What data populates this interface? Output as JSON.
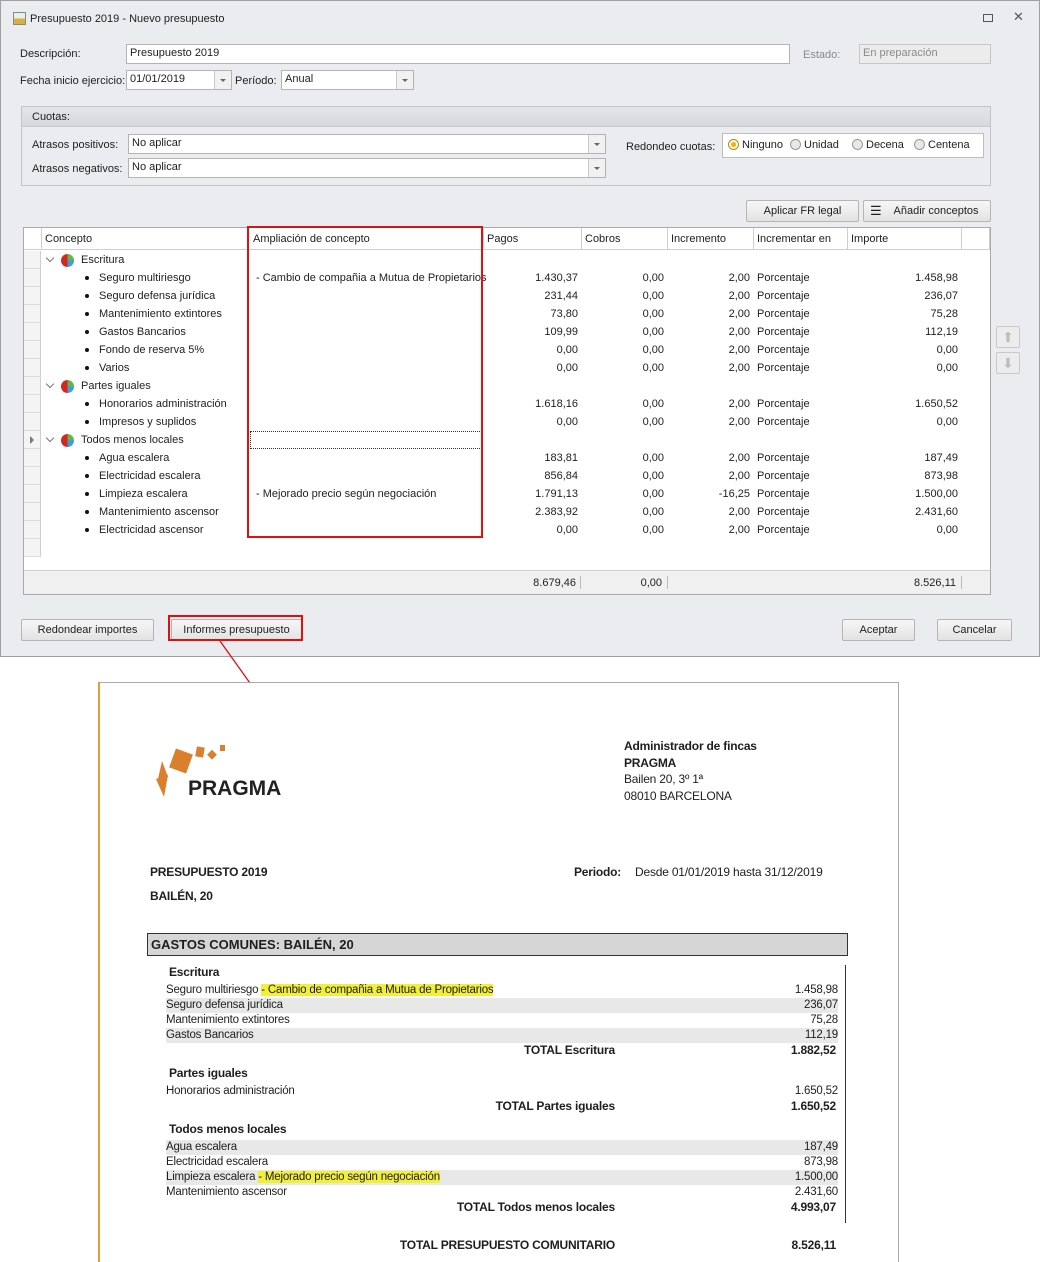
{
  "window": {
    "title": "Presupuesto 2019 - Nuevo presupuesto"
  },
  "form": {
    "descripcion_label": "Descripción:",
    "descripcion_value": "Presupuesto 2019",
    "estado_label": "Estado:",
    "estado_value": "En preparación",
    "fecha_label": "Fecha inicio ejercicio:",
    "fecha_value": "01/01/2019",
    "periodo_label": "Período:",
    "periodo_value": "Anual"
  },
  "cuotas": {
    "title": "Cuotas:",
    "atrasos_pos_label": "Atrasos positivos:",
    "atrasos_pos_value": "No aplicar",
    "atrasos_neg_label": "Atrasos negativos:",
    "atrasos_neg_value": "No aplicar",
    "redondeo_label": "Redondeo cuotas:",
    "redondeo_options": [
      "Ninguno",
      "Unidad",
      "Decena",
      "Centena"
    ],
    "redondeo_selected": "Ninguno"
  },
  "toolbar": {
    "aplicar_fr": "Aplicar FR legal",
    "anadir": "Añadir conceptos"
  },
  "grid": {
    "columns": [
      "Concepto",
      "Ampliación de concepto",
      "Pagos",
      "Cobros",
      "Incremento",
      "Incrementar en",
      "Importe"
    ],
    "rows": [
      {
        "group": "Escritura"
      },
      {
        "c": "Seguro multiriesgo",
        "a": "- Cambio de compañia a Mutua de Propietarios",
        "p": "1.430,37",
        "co": "0,00",
        "i": "2,00",
        "e": "Porcentaje",
        "im": "1.458,98"
      },
      {
        "c": "Seguro defensa jurídica",
        "a": "",
        "p": "231,44",
        "co": "0,00",
        "i": "2,00",
        "e": "Porcentaje",
        "im": "236,07"
      },
      {
        "c": "Mantenimiento extintores",
        "a": "",
        "p": "73,80",
        "co": "0,00",
        "i": "2,00",
        "e": "Porcentaje",
        "im": "75,28"
      },
      {
        "c": "Gastos Bancarios",
        "a": "",
        "p": "109,99",
        "co": "0,00",
        "i": "2,00",
        "e": "Porcentaje",
        "im": "112,19"
      },
      {
        "c": "Fondo de reserva 5%",
        "a": "",
        "p": "0,00",
        "co": "0,00",
        "i": "2,00",
        "e": "Porcentaje",
        "im": "0,00"
      },
      {
        "c": "Varios",
        "a": "",
        "p": "0,00",
        "co": "0,00",
        "i": "2,00",
        "e": "Porcentaje",
        "im": "0,00"
      },
      {
        "group": "Partes iguales"
      },
      {
        "c": "Honorarios administración",
        "a": "",
        "p": "1.618,16",
        "co": "0,00",
        "i": "2,00",
        "e": "Porcentaje",
        "im": "1.650,52"
      },
      {
        "c": "Impresos y suplidos",
        "a": "",
        "p": "0,00",
        "co": "0,00",
        "i": "2,00",
        "e": "Porcentaje",
        "im": "0,00"
      },
      {
        "group": "Todos menos locales",
        "current": true
      },
      {
        "c": "Agua escalera",
        "a": "",
        "p": "183,81",
        "co": "0,00",
        "i": "2,00",
        "e": "Porcentaje",
        "im": "187,49"
      },
      {
        "c": "Electricidad escalera",
        "a": "",
        "p": "856,84",
        "co": "0,00",
        "i": "2,00",
        "e": "Porcentaje",
        "im": "873,98"
      },
      {
        "c": "Limpieza escalera",
        "a": "- Mejorado precio según negociación",
        "p": "1.791,13",
        "co": "0,00",
        "i": "-16,25",
        "e": "Porcentaje",
        "im": "1.500,00"
      },
      {
        "c": "Mantenimiento ascensor",
        "a": "",
        "p": "2.383,92",
        "co": "0,00",
        "i": "2,00",
        "e": "Porcentaje",
        "im": "2.431,60"
      },
      {
        "c": "Electricidad ascensor",
        "a": "",
        "p": "0,00",
        "co": "0,00",
        "i": "2,00",
        "e": "Porcentaje",
        "im": "0,00"
      }
    ],
    "totals": {
      "pagos": "8.679,46",
      "cobros": "0,00",
      "importe": "8.526,11"
    }
  },
  "buttons": {
    "redondear": "Redondear importes",
    "informes": "Informes presupuesto",
    "aceptar": "Aceptar",
    "cancelar": "Cancelar"
  },
  "report": {
    "logo_text": "PRAGMA",
    "company": [
      "Administrador de fincas",
      "PRAGMA",
      "Bailen 20, 3º 1ª",
      "08010 BARCELONA"
    ],
    "title": "PRESUPUESTO 2019",
    "building": "BAILÉN, 20",
    "periodo_label": "Periodo:",
    "periodo_value": "Desde 01/01/2019 hasta 31/12/2019",
    "section": "GASTOS COMUNES: BAILÉN, 20",
    "groups": [
      {
        "name": "Escritura",
        "items": [
          {
            "c": "Seguro multiriesgo",
            "a": "- Cambio de compañia a Mutua de Propietarios",
            "v": "1.458,98"
          },
          {
            "c": "Seguro defensa jurídica",
            "a": "",
            "v": "236,07"
          },
          {
            "c": "Mantenimiento extintores",
            "a": "",
            "v": "75,28"
          },
          {
            "c": "Gastos Bancarios",
            "a": "",
            "v": "112,19"
          }
        ],
        "total_label": "TOTAL Escritura",
        "total": "1.882,52"
      },
      {
        "name": "Partes iguales",
        "items": [
          {
            "c": "Honorarios administración",
            "a": "",
            "v": "1.650,52"
          }
        ],
        "total_label": "TOTAL Partes iguales",
        "total": "1.650,52"
      },
      {
        "name": "Todos menos locales",
        "items": [
          {
            "c": "Agua escalera",
            "a": "",
            "v": "187,49"
          },
          {
            "c": "Electricidad escalera",
            "a": "",
            "v": "873,98"
          },
          {
            "c": "Limpieza escalera",
            "a": "- Mejorado precio según negociación",
            "v": "1.500,00"
          },
          {
            "c": "Mantenimiento ascensor",
            "a": "",
            "v": "2.431,60"
          }
        ],
        "total_label": "TOTAL Todos menos locales",
        "total": "4.993,07"
      }
    ],
    "grand_total_label": "TOTAL PRESUPUESTO COMUNITARIO",
    "grand_total": "8.526,11"
  },
  "colors": {
    "highlight": "#f2ef3a",
    "annotation": "#e01010",
    "logo": "#d97f2e"
  }
}
